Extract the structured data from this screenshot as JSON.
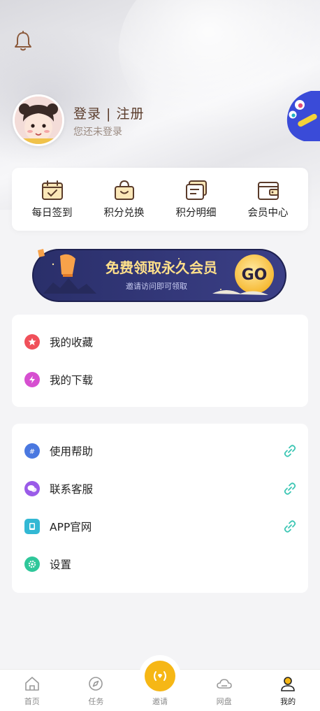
{
  "header": {
    "bell_icon": "bell-icon",
    "login_text": "登录 | 注册",
    "login_subtitle": "您还未登录"
  },
  "quick_actions": [
    {
      "label": "每日签到",
      "icon": "calendar-check-icon"
    },
    {
      "label": "积分兑换",
      "icon": "shopping-bag-icon"
    },
    {
      "label": "积分明细",
      "icon": "list-detail-icon"
    },
    {
      "label": "会员中心",
      "icon": "wallet-icon"
    }
  ],
  "banner": {
    "title": "免费领取永久会员",
    "subtitle": "邀请访问即可领取",
    "cta": "GO"
  },
  "list1": [
    {
      "label": "我的收藏",
      "icon": "star-icon",
      "color": "#f0505a"
    },
    {
      "label": "我的下载",
      "icon": "lightning-icon",
      "color": "#d64fd0"
    }
  ],
  "list2": [
    {
      "label": "使用帮助",
      "icon": "help-icon",
      "color": "#4a78e0",
      "link": true
    },
    {
      "label": "联系客服",
      "icon": "wechat-icon",
      "color": "#9a5be8",
      "link": true
    },
    {
      "label": "APP官网",
      "icon": "tablet-icon",
      "color": "#32b8d4",
      "link": true
    },
    {
      "label": "设置",
      "icon": "gear-icon",
      "color": "#2fc79a",
      "link": false
    }
  ],
  "tabbar": [
    {
      "label": "首页",
      "icon": "home-icon"
    },
    {
      "label": "任务",
      "icon": "compass-icon"
    },
    {
      "label": "邀请",
      "icon": "broadcast-icon"
    },
    {
      "label": "网盘",
      "icon": "cloud-icon"
    },
    {
      "label": "我的",
      "icon": "user-icon",
      "active": true
    }
  ],
  "colors": {
    "accent": "#f6b715",
    "brand_brown": "#5a3b2a",
    "link_teal": "#3cc6b4"
  }
}
